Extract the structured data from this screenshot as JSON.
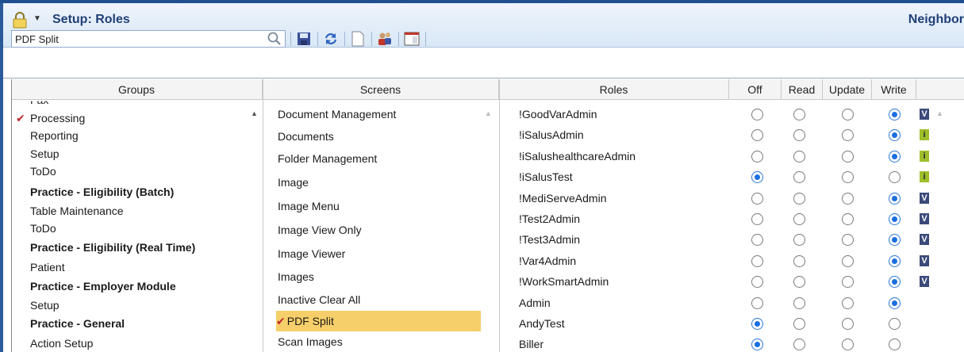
{
  "window": {
    "title": "Setup: Roles",
    "right_label": "Neighbor"
  },
  "toolbar": {
    "search_value": "PDF Split",
    "icons": [
      "search-icon",
      "save-icon",
      "refresh-icon",
      "new-document-icon",
      "users-icon",
      "window-icon"
    ]
  },
  "columns": {
    "groups": "Groups",
    "screens": "Screens",
    "roles": "Roles",
    "off": "Off",
    "read": "Read",
    "update": "Update",
    "write": "Write"
  },
  "groups": [
    {
      "label": "Fax",
      "bold": false,
      "checked": false
    },
    {
      "label": "Processing",
      "bold": false,
      "checked": true
    },
    {
      "label": "Reporting",
      "bold": false,
      "checked": false
    },
    {
      "label": "Setup",
      "bold": false,
      "checked": false
    },
    {
      "label": "ToDo",
      "bold": false,
      "checked": false
    },
    {
      "label": "Practice - Eligibility (Batch)",
      "bold": true,
      "checked": false
    },
    {
      "label": "Table Maintenance",
      "bold": false,
      "checked": false
    },
    {
      "label": "ToDo",
      "bold": false,
      "checked": false
    },
    {
      "label": "Practice - Eligibility (Real Time)",
      "bold": true,
      "checked": false
    },
    {
      "label": "Patient",
      "bold": false,
      "checked": false
    },
    {
      "label": "Practice - Employer Module",
      "bold": true,
      "checked": false
    },
    {
      "label": "Setup",
      "bold": false,
      "checked": false
    },
    {
      "label": "Practice - General",
      "bold": true,
      "checked": false
    },
    {
      "label": "Action Setup",
      "bold": false,
      "checked": false
    }
  ],
  "screens": [
    {
      "label": "Document Management",
      "selected": false
    },
    {
      "label": "Documents",
      "selected": false
    },
    {
      "label": "Folder Management",
      "selected": false
    },
    {
      "label": "Image",
      "selected": false
    },
    {
      "label": "Image Menu",
      "selected": false
    },
    {
      "label": "Image View Only",
      "selected": false
    },
    {
      "label": "Image Viewer",
      "selected": false
    },
    {
      "label": "Images",
      "selected": false
    },
    {
      "label": "Inactive Clear All",
      "selected": false
    },
    {
      "label": "PDF Split",
      "selected": true
    },
    {
      "label": "Scan Images",
      "selected": false
    }
  ],
  "roles": [
    {
      "name": "!GoodVarAdmin",
      "access": "write",
      "badge": "V"
    },
    {
      "name": "!iSalusAdmin",
      "access": "write",
      "badge": "i"
    },
    {
      "name": "!iSalushealthcareAdmin",
      "access": "write",
      "badge": "i"
    },
    {
      "name": "!iSalusTest",
      "access": "off",
      "badge": "i"
    },
    {
      "name": "!MediServeAdmin",
      "access": "write",
      "badge": "V"
    },
    {
      "name": "!Test2Admin",
      "access": "write",
      "badge": "V"
    },
    {
      "name": "!Test3Admin",
      "access": "write",
      "badge": "V"
    },
    {
      "name": "!Var4Admin",
      "access": "write",
      "badge": "V"
    },
    {
      "name": "!WorkSmartAdmin",
      "access": "write",
      "badge": "V"
    },
    {
      "name": "Admin",
      "access": "write",
      "badge": ""
    },
    {
      "name": "AndyTest",
      "access": "off",
      "badge": ""
    },
    {
      "name": "Biller",
      "access": "off",
      "badge": ""
    }
  ],
  "colors": {
    "title_text": "#1f3f77",
    "selected_row": "#f7cf6a",
    "check": "#c0262a",
    "radio_on": "#1a6fe0"
  }
}
